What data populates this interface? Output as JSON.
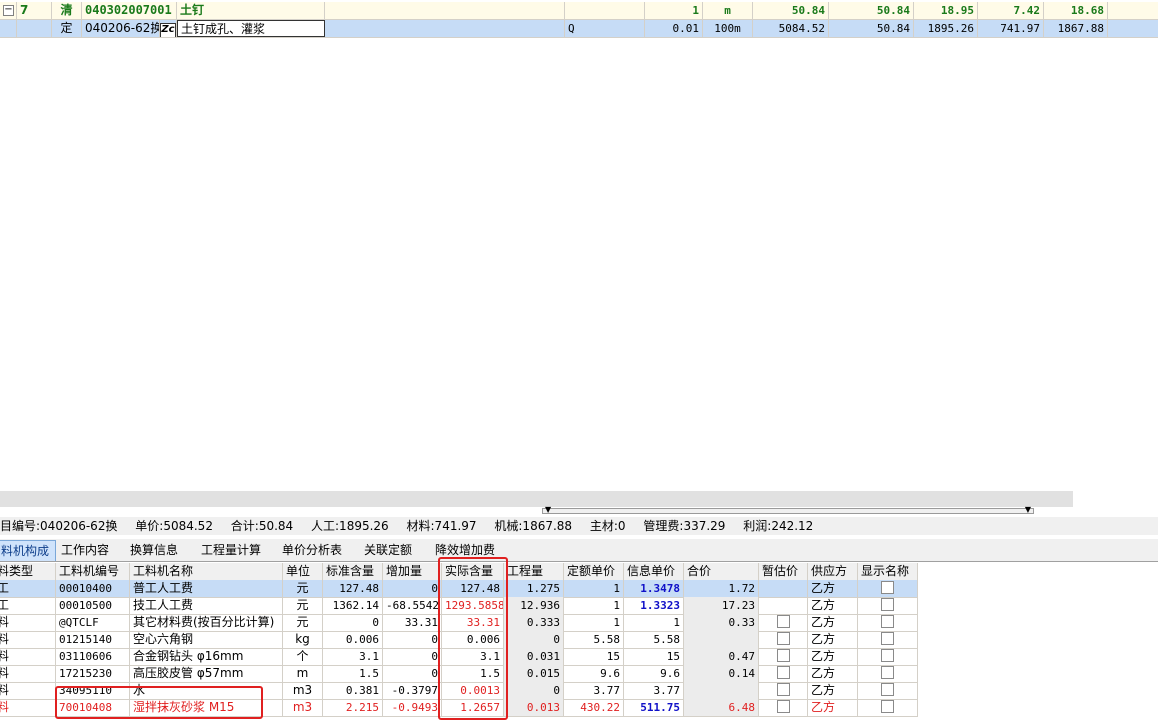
{
  "upper": {
    "row1": {
      "seq": "7",
      "type": "清",
      "code": "040302007001",
      "name": "土钉",
      "qty": "1",
      "unit": "m",
      "c1": "50.84",
      "c2": "50.84",
      "c3": "18.95",
      "c4": "7.42",
      "c5": "18.68"
    },
    "row2": {
      "type": "定",
      "code": "040206-62换",
      "name": "土钉成孔、灌浆",
      "mark": "Q",
      "qty": "0.01",
      "unit": "100m",
      "c1": "5084.52",
      "c2": "50.84",
      "c3": "1895.26",
      "c4": "741.97",
      "c5": "1867.88"
    }
  },
  "summary": {
    "code": "目编号:040206-62换",
    "unit_price": "单价:5084.52",
    "total": "合计:50.84",
    "labor": "人工:1895.26",
    "material": "材料:741.97",
    "machine": "机械:1867.88",
    "main_material": "主材:0",
    "mgmt_fee": "管理费:337.29",
    "profit": "利润:242.12"
  },
  "tabs": [
    "料机构成",
    "工作内容",
    "换算信息",
    "工程量计算",
    "单价分析表",
    "关联定额",
    "降效增加费"
  ],
  "grid": {
    "headers": [
      "料类型",
      "工料机编号",
      "工料机名称",
      "单位",
      "标准含量",
      "增加量",
      "实际含量",
      "工程量",
      "定额单价",
      "信息单价",
      "合价",
      "暂估价",
      "供应方",
      "显示名称"
    ],
    "rows": [
      {
        "t": "工",
        "code": "00010400",
        "name": "普工人工费",
        "unit": "元",
        "std": "127.48",
        "add": "0",
        "act": "127.48",
        "qty": "1.275",
        "qp": "1",
        "ip": "1.3478",
        "sum": "1.72",
        "sup": "乙方"
      },
      {
        "t": "工",
        "code": "00010500",
        "name": "技工人工费",
        "unit": "元",
        "std": "1362.14",
        "add": "-68.5542",
        "act": "1293.5858",
        "qty": "12.936",
        "qp": "1",
        "ip": "1.3323",
        "sum": "17.23",
        "sup": "乙方"
      },
      {
        "t": "料",
        "code": "@QTCLF",
        "name": "其它材料费(按百分比计算)",
        "unit": "元",
        "std": "0",
        "add": "33.31",
        "act": "33.31",
        "qty": "0.333",
        "qp": "1",
        "ip": "1",
        "sum": "0.33",
        "sup": "乙方"
      },
      {
        "t": "料",
        "code": "01215140",
        "name": "空心六角钢",
        "unit": "kg",
        "std": "0.006",
        "add": "0",
        "act": "0.006",
        "qty": "0",
        "qp": "5.58",
        "ip": "5.58",
        "sum": "",
        "sup": "乙方"
      },
      {
        "t": "料",
        "code": "03110606",
        "name": "合金钢钻头 φ16mm",
        "unit": "个",
        "std": "3.1",
        "add": "0",
        "act": "3.1",
        "qty": "0.031",
        "qp": "15",
        "ip": "15",
        "sum": "0.47",
        "sup": "乙方"
      },
      {
        "t": "料",
        "code": "17215230",
        "name": "高压胶皮管 φ57mm",
        "unit": "m",
        "std": "1.5",
        "add": "0",
        "act": "1.5",
        "qty": "0.015",
        "qp": "9.6",
        "ip": "9.6",
        "sum": "0.14",
        "sup": "乙方"
      },
      {
        "t": "料",
        "code": "34095110",
        "name": "水",
        "unit": "m3",
        "std": "0.381",
        "add": "-0.3797",
        "act": "0.0013",
        "qty": "0",
        "qp": "3.77",
        "ip": "3.77",
        "sum": "",
        "sup": "乙方"
      },
      {
        "t": "料",
        "code": "70010408",
        "name": "湿拌抹灰砂浆 M15",
        "unit": "m3",
        "std": "2.215",
        "add": "-0.9493",
        "act": "1.2657",
        "qty": "0.013",
        "qp": "430.22",
        "ip": "511.75",
        "sum": "6.48",
        "sup": "乙方"
      }
    ]
  },
  "colors": {
    "selection": "#c6dcf6",
    "highlight_red": "#e02020",
    "info_price_blue": "#1010c8",
    "code_green": "#1a7a1a"
  },
  "icons": {
    "collapse": "minus-box-icon",
    "zc": "zc-icon",
    "splitter": "splitter-arrow-icon"
  }
}
